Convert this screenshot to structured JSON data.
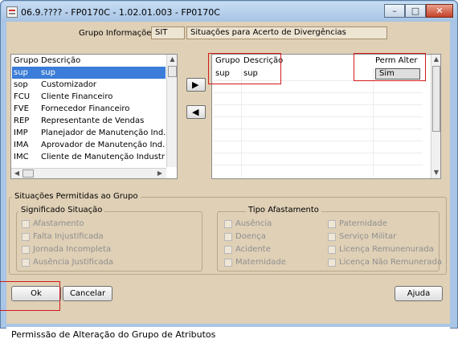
{
  "window": {
    "title": "06.9.???? - FP0170C - 1.02.01.003 - FP0170C",
    "controls": {
      "minimize": "–",
      "maximize": "□",
      "close": "✕"
    }
  },
  "header": {
    "label": "Grupo Informações:",
    "code": "SIT",
    "description": "Situações para Acerto de Divergências"
  },
  "left_list": {
    "columns": [
      "Grupo",
      "Descrição"
    ],
    "rows": [
      [
        "sup",
        "sup"
      ],
      [
        "sop",
        "Customizador"
      ],
      [
        "FCU",
        "Cliente Financeiro"
      ],
      [
        "FVE",
        "Fornecedor Financeiro"
      ],
      [
        "REP",
        "Representante de Vendas"
      ],
      [
        "IMP",
        "Planejador de Manutenção Ind."
      ],
      [
        "IMA",
        "Aprovador de Manutenção Ind."
      ],
      [
        "IMC",
        "Cliente de Manutenção Industr"
      ]
    ],
    "selected_index": 0
  },
  "right_list": {
    "columns": [
      "Grupo",
      "Descrição",
      "Perm Alter"
    ],
    "rows": [
      [
        "sup",
        "sup",
        "Sim"
      ]
    ]
  },
  "arrows": {
    "add": "▶",
    "remove": "◀"
  },
  "situacoes": {
    "title": "Situações Permitidas ao Grupo",
    "significado": {
      "title": "Significado Situação",
      "items": [
        "Afastamento",
        "Falta Injustificada",
        "Jornada Incompleta",
        "Ausência Justificada"
      ]
    },
    "tipo": {
      "title": "Tipo Afastamento",
      "col1": [
        "Ausência",
        "Doença",
        "Acidente",
        "Maternidade"
      ],
      "col2": [
        "Paternidade",
        "Serviço Militar",
        "Licença Remunenurada",
        "Licença Não Remunerada"
      ]
    }
  },
  "buttons": {
    "ok": "Ok",
    "cancel": "Cancelar",
    "help": "Ajuda"
  },
  "status": "Permissão de Alteração do Grupo de Atributos",
  "colors": {
    "background": "#dfd0b6",
    "selection": "#3b7dd8",
    "highlight": "#d11a1a"
  }
}
